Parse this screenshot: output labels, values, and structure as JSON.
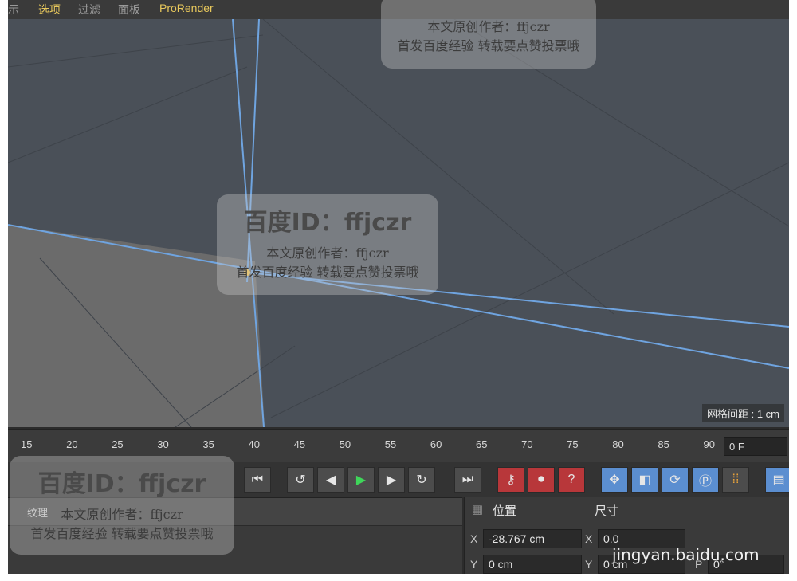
{
  "menu": {
    "items": [
      "示",
      "选项",
      "过滤",
      "面板",
      "ProRender"
    ]
  },
  "viewport": {
    "grid_label": "网格间距 : 1 cm"
  },
  "timeline": {
    "ticks": [
      "15",
      "20",
      "25",
      "30",
      "35",
      "40",
      "45",
      "50",
      "55",
      "60",
      "65",
      "70",
      "75",
      "80",
      "85",
      "90"
    ],
    "current_frame": "0 F"
  },
  "lower_left": {
    "tab_label": "纹理"
  },
  "attributes": {
    "position_label": "位置",
    "size_label": "尺寸",
    "x_label": "X",
    "y_label": "Y",
    "p_label": "P",
    "pos_x": "-28.767 cm",
    "pos_y": "0 cm",
    "size_x": "0.0",
    "size_y": "0 cm",
    "rot_p": "0°"
  },
  "watermark": {
    "id_text": "百度ID：ffjczr",
    "author_line": "本文原创作者：ffjczr",
    "notice_line": "首发百度经验 转载要点赞投票哦",
    "site_text": "jingyan.baidu.com"
  },
  "colors": {
    "viewport_bg": "#4a5058",
    "floor": "#6b6b6b",
    "axis_line": "#6fa4e0",
    "play_green": "#3fd65a",
    "record_red": "#b8373a",
    "tool_blue": "#5b8ed0"
  }
}
